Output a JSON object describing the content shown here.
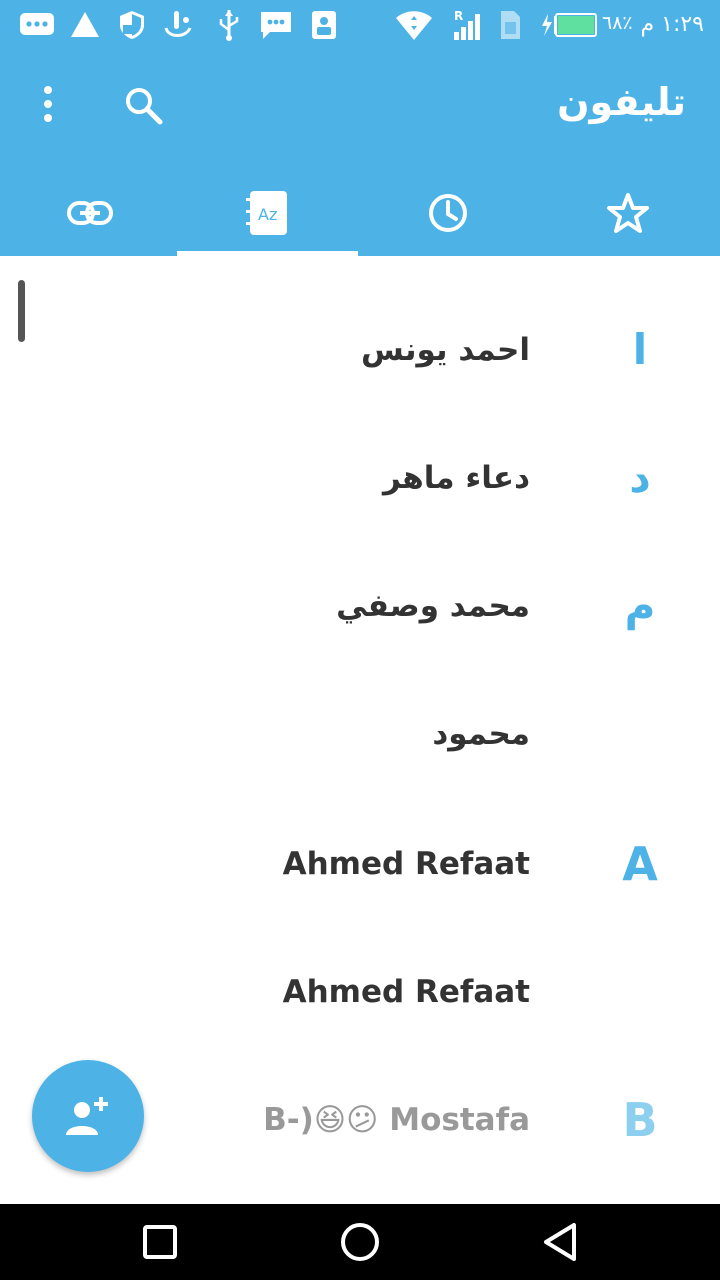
{
  "status_bar": {
    "time": "١:٢٩ م",
    "battery_percent": "٦٨٪",
    "icons": [
      "message-bubble-icon",
      "warning-icon",
      "shield-icon",
      "touch-gesture-icon",
      "usb-icon",
      "sms-icon",
      "sim-manager-icon",
      "wifi-icon",
      "signal-icon",
      "sim-card-icon",
      "battery-charging-icon"
    ]
  },
  "app_bar": {
    "title": "تليفون",
    "actions": [
      "more-icon",
      "search-icon"
    ]
  },
  "tabs": [
    {
      "icon": "link-icon",
      "selected": false
    },
    {
      "icon": "contacts-az-icon",
      "selected": true
    },
    {
      "icon": "clock-icon",
      "selected": false
    },
    {
      "icon": "star-icon",
      "selected": false
    }
  ],
  "contacts": [
    {
      "letter": "ا",
      "name": "احمد يونس"
    },
    {
      "letter": "د",
      "name": "دعاء ماهر"
    },
    {
      "letter": "م",
      "name": "محمد وصفي"
    },
    {
      "letter": "",
      "name": "محمود"
    },
    {
      "letter": "A",
      "name": "Ahmed Refaat"
    },
    {
      "letter": "",
      "name": "Ahmed Refaat"
    },
    {
      "letter": "B",
      "name": "B-)😆😕 Mostafa"
    }
  ],
  "fab": {
    "icon": "add-contact-icon"
  },
  "nav_bar": {
    "buttons": [
      "recent-apps-icon",
      "home-icon",
      "back-icon"
    ]
  },
  "colors": {
    "primary": "#4db3e6",
    "indicator": "#ffffff",
    "text": "#333333"
  }
}
